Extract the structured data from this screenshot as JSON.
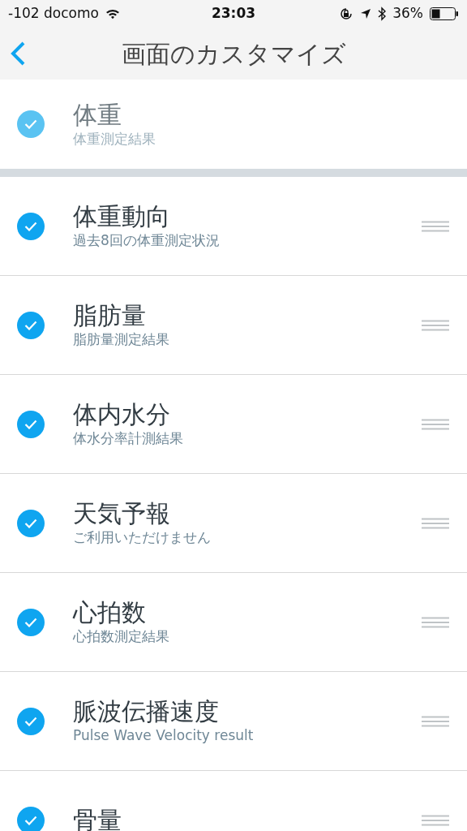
{
  "status_bar": {
    "carrier": "-102 docomo",
    "time": "23:03",
    "battery": "36%"
  },
  "nav": {
    "title": "画面のカスタマイズ"
  },
  "items": [
    {
      "title": "体重",
      "subtitle": "体重測定結果",
      "checked": true,
      "disabled": true
    },
    {
      "title": "体重動向",
      "subtitle": "過去8回の体重測定状況",
      "checked": true,
      "disabled": false
    },
    {
      "title": "脂肪量",
      "subtitle": "脂肪量測定結果",
      "checked": true,
      "disabled": false
    },
    {
      "title": "体内水分",
      "subtitle": "体水分率計測結果",
      "checked": true,
      "disabled": false
    },
    {
      "title": "天気予報",
      "subtitle": "ご利用いただけません",
      "checked": true,
      "disabled": false
    },
    {
      "title": "心拍数",
      "subtitle": "心拍数測定結果",
      "checked": true,
      "disabled": false
    },
    {
      "title": "脈波伝播速度",
      "subtitle": "Pulse Wave Velocity result",
      "checked": true,
      "disabled": false
    },
    {
      "title": "骨量",
      "checked": true,
      "disabled": false
    }
  ]
}
